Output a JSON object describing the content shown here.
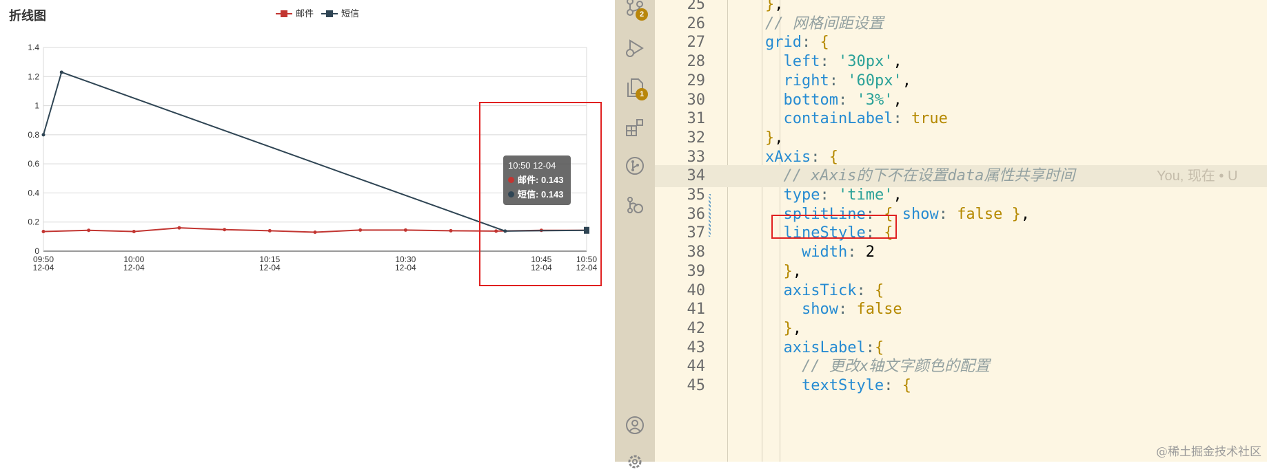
{
  "chart_data": {
    "type": "line",
    "title": "折线图",
    "xlabel": "",
    "ylabel": "",
    "ylim": [
      0,
      1.4
    ],
    "y_ticks": [
      "0",
      "0.2",
      "0.4",
      "0.6",
      "0.8",
      "1",
      "1.2",
      "1.4"
    ],
    "x_ticks": [
      {
        "time": "09:50",
        "date": "12-04"
      },
      {
        "time": "10:00",
        "date": "12-04"
      },
      {
        "time": "10:15",
        "date": "12-04"
      },
      {
        "time": "10:30",
        "date": "12-04"
      },
      {
        "time": "10:45",
        "date": "12-04"
      },
      {
        "time": "10:50",
        "date": "12-04"
      }
    ],
    "grid": true,
    "legend_position": "top-center",
    "series": [
      {
        "name": "邮件",
        "color": "#c23531",
        "marker": "circle",
        "points": [
          [
            "09:50",
            0.135
          ],
          [
            "09:55",
            0.143
          ],
          [
            "10:00",
            0.135
          ],
          [
            "10:05",
            0.16
          ],
          [
            "10:10",
            0.148
          ],
          [
            "10:15",
            0.14
          ],
          [
            "10:20",
            0.13
          ],
          [
            "10:25",
            0.145
          ],
          [
            "10:30",
            0.145
          ],
          [
            "10:35",
            0.14
          ],
          [
            "10:40",
            0.138
          ],
          [
            "10:45",
            0.143
          ],
          [
            "10:50",
            0.143
          ]
        ]
      },
      {
        "name": "短信",
        "color": "#2f4554",
        "marker": "circle",
        "points": [
          [
            "09:50",
            0.8
          ],
          [
            "09:52",
            1.23
          ],
          [
            "10:41",
            0.138
          ],
          [
            "10:50",
            0.143
          ]
        ]
      }
    ],
    "tooltip": {
      "header": "10:50 12-04",
      "rows": [
        {
          "name": "邮件",
          "value": "0.143",
          "color": "#c23531"
        },
        {
          "name": "短信",
          "value": "0.143",
          "color": "#2f4554"
        }
      ]
    }
  },
  "activity_bar": {
    "icons": [
      "source-control-icon",
      "run-debug-icon",
      "explorer-icon",
      "extensions-icon",
      "git-graph-icon",
      "remote-icon",
      "account-icon",
      "settings-icon"
    ],
    "badges": {
      "source_control": "2",
      "explorer": "1"
    }
  },
  "editor": {
    "lines": [
      {
        "no": "25",
        "text": "    },"
      },
      {
        "no": "26",
        "text": "    // 网格间距设置"
      },
      {
        "no": "27",
        "text": "    grid: {"
      },
      {
        "no": "28",
        "text": "      left: '30px',"
      },
      {
        "no": "29",
        "text": "      right: '60px',"
      },
      {
        "no": "30",
        "text": "      bottom: '3%',"
      },
      {
        "no": "31",
        "text": "      containLabel: true"
      },
      {
        "no": "32",
        "text": "    },"
      },
      {
        "no": "33",
        "text": "    xAxis: {"
      },
      {
        "no": "34",
        "text": "      // xAxis的下不在设置data属性共享时间"
      },
      {
        "no": "35",
        "text": "      type: 'time',"
      },
      {
        "no": "36",
        "text": "      splitLine: { show: false },"
      },
      {
        "no": "37",
        "text": "      lineStyle: {"
      },
      {
        "no": "38",
        "text": "        width: 2"
      },
      {
        "no": "39",
        "text": "      },"
      },
      {
        "no": "40",
        "text": "      axisTick: {"
      },
      {
        "no": "41",
        "text": "        show: false"
      },
      {
        "no": "42",
        "text": "      },"
      },
      {
        "no": "43",
        "text": "      axisLabel:{"
      },
      {
        "no": "44",
        "text": "        // 更改x轴文字颜色的配置"
      },
      {
        "no": "45",
        "text": "        textStyle: {"
      }
    ],
    "blame_annotation": "You, 现在 • U"
  },
  "watermark": "@稀土掘金技术社区"
}
